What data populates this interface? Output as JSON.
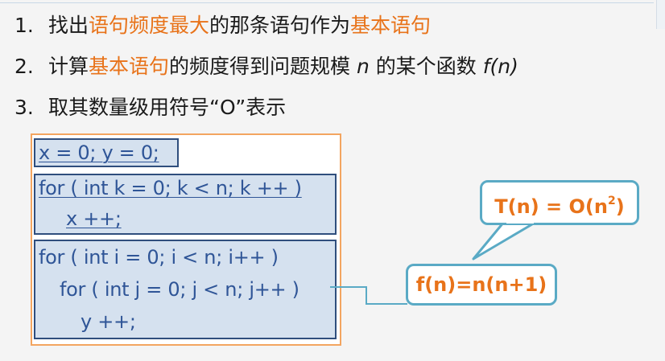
{
  "steps": [
    {
      "number": "1.",
      "pre": "找出",
      "highlight": "语句频度最大",
      "mid": "的那条语句作为",
      "highlight2": "基本语句",
      "post": ""
    },
    {
      "number": "2.",
      "pre": "计算",
      "highlight": "基本语句",
      "mid": "的频度得到问题规模 ",
      "var": "n",
      "mid2": " 的某个函数 ",
      "func": "f(n)"
    },
    {
      "number": "3.",
      "text": "取其数量级用符号“O”表示"
    }
  ],
  "code": {
    "init": "x = 0;  y = 0;",
    "loop1_head": "for ( int k = 0; k < n; k ++ )",
    "loop1_body": "x ++;",
    "loop2_head": "for ( int i = 0; i < n; i++ )",
    "loop2_inner": "for ( int j = 0; j < n; j++ )",
    "loop2_body": "y ++;"
  },
  "callouts": {
    "complexity_prefix": "T(n)  =  O(n",
    "complexity_exp": "2",
    "complexity_suffix": ")",
    "frequency": "f(n)=n(n+1)"
  },
  "colors": {
    "highlight": "#e8731a",
    "code_text": "#2f5597",
    "code_block_bg": "#d5e1ef",
    "code_block_border": "#2f4e7d",
    "outer_border": "#f3a560",
    "callout_border": "#5aaac5"
  }
}
